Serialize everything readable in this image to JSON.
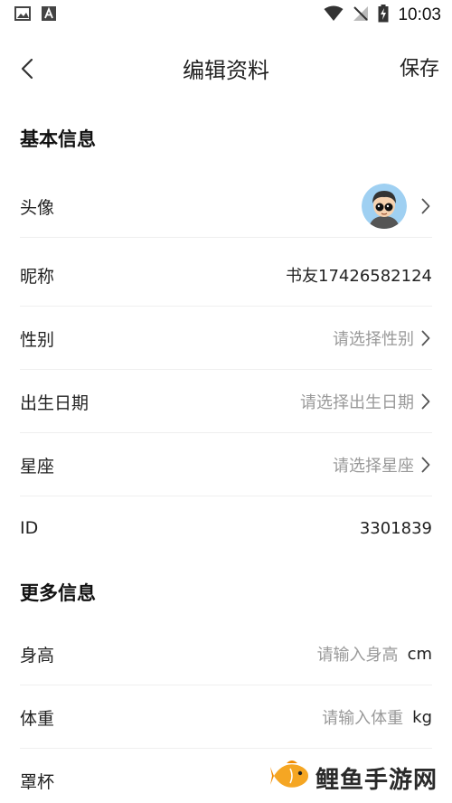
{
  "status_bar": {
    "time": "10:03",
    "left_icons": [
      "image-icon",
      "font-icon"
    ],
    "right_icons": [
      "wifi-icon",
      "signal-off-icon",
      "battery-charging-icon"
    ]
  },
  "header": {
    "title": "编辑资料",
    "save_label": "保存",
    "back_icon": "chevron-left-icon"
  },
  "basic_info": {
    "section_title": "基本信息",
    "avatar": {
      "label": "头像"
    },
    "nickname": {
      "label": "昵称",
      "value": "书友17426582124"
    },
    "gender": {
      "label": "性别",
      "placeholder": "请选择性别"
    },
    "birthday": {
      "label": "出生日期",
      "placeholder": "请选择出生日期"
    },
    "zodiac": {
      "label": "星座",
      "placeholder": "请选择星座"
    },
    "id": {
      "label": "ID",
      "value": "3301839"
    }
  },
  "more_info": {
    "section_title": "更多信息",
    "height": {
      "label": "身高",
      "placeholder": "请输入身高",
      "unit": "cm"
    },
    "weight": {
      "label": "体重",
      "placeholder": "请输入体重",
      "unit": "kg"
    },
    "cup": {
      "label": "罩杯"
    }
  },
  "watermark": {
    "text": "鲤鱼手游网"
  },
  "colors": {
    "placeholder": "#999999",
    "divider": "#efefef",
    "text": "#222222",
    "avatar_bg": "#9fd0f2",
    "watermark_fish": "#f5a623"
  }
}
